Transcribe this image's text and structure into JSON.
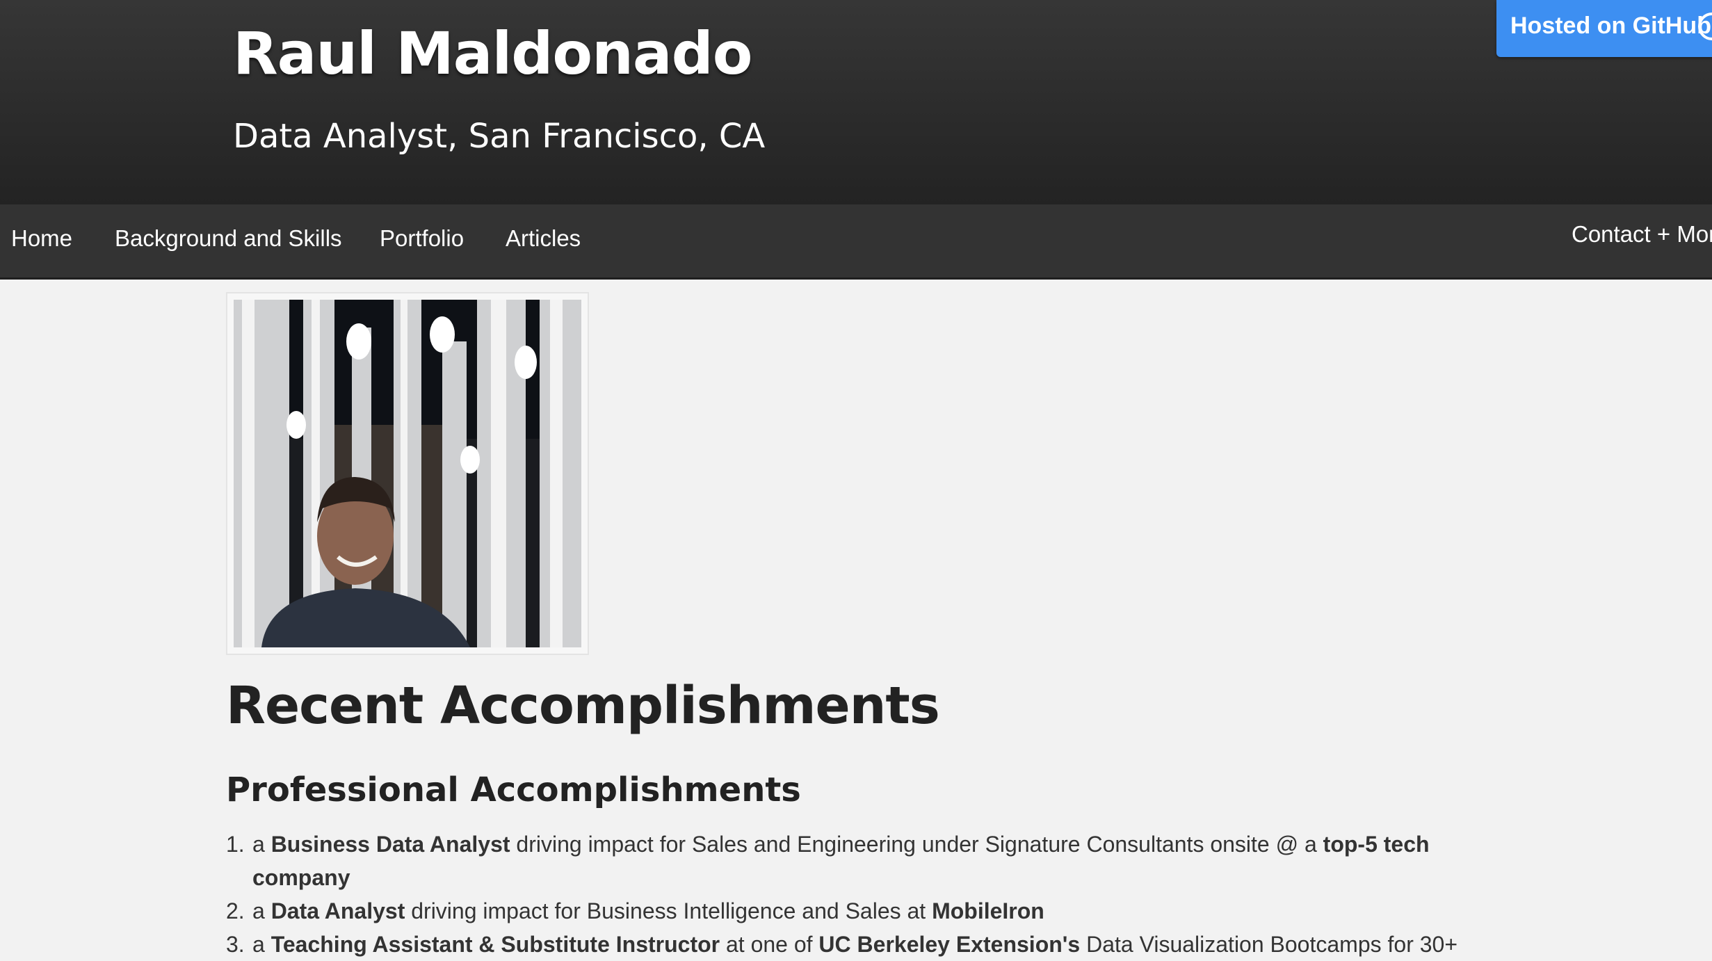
{
  "header": {
    "title": "Raul Maldonado",
    "subtitle": "Data Analyst, San Francisco, CA"
  },
  "github_ribbon": {
    "label": "Hosted on GitHub",
    "icon": "github-icon"
  },
  "nav": {
    "home": "Home",
    "background": "Background and Skills",
    "portfolio": "Portfolio",
    "articles": "Articles",
    "contact": "Contact + More"
  },
  "main": {
    "recent_heading": "Recent Accomplishments",
    "professional_heading": "Professional Accomplishments",
    "accomplishments": [
      {
        "num": "1.",
        "p1": "a ",
        "b1": "Business Data Analyst",
        "p2": " driving impact for Sales and Engineering under Signature Consultants onsite @ a ",
        "b2": "top-5 tech company",
        "p3": ""
      },
      {
        "num": "2.",
        "p1": "a ",
        "b1": "Data Analyst",
        "p2": " driving impact for Business Intelligence and Sales at ",
        "b2": "MobileIron",
        "p3": ""
      },
      {
        "num": "3.",
        "p1": "a ",
        "b1": "Teaching Assistant & Substitute Instructor",
        "p2": " at one of ",
        "b2": "UC Berkeley Extension's",
        "p3": " Data Visualization Bootcamps for 30+"
      }
    ]
  },
  "colors": {
    "header_bg": "#2b2b2b",
    "nav_bg": "#333333",
    "ribbon_bg": "#3d8ff2",
    "page_bg": "#f2f2f2",
    "text": "#333333"
  }
}
